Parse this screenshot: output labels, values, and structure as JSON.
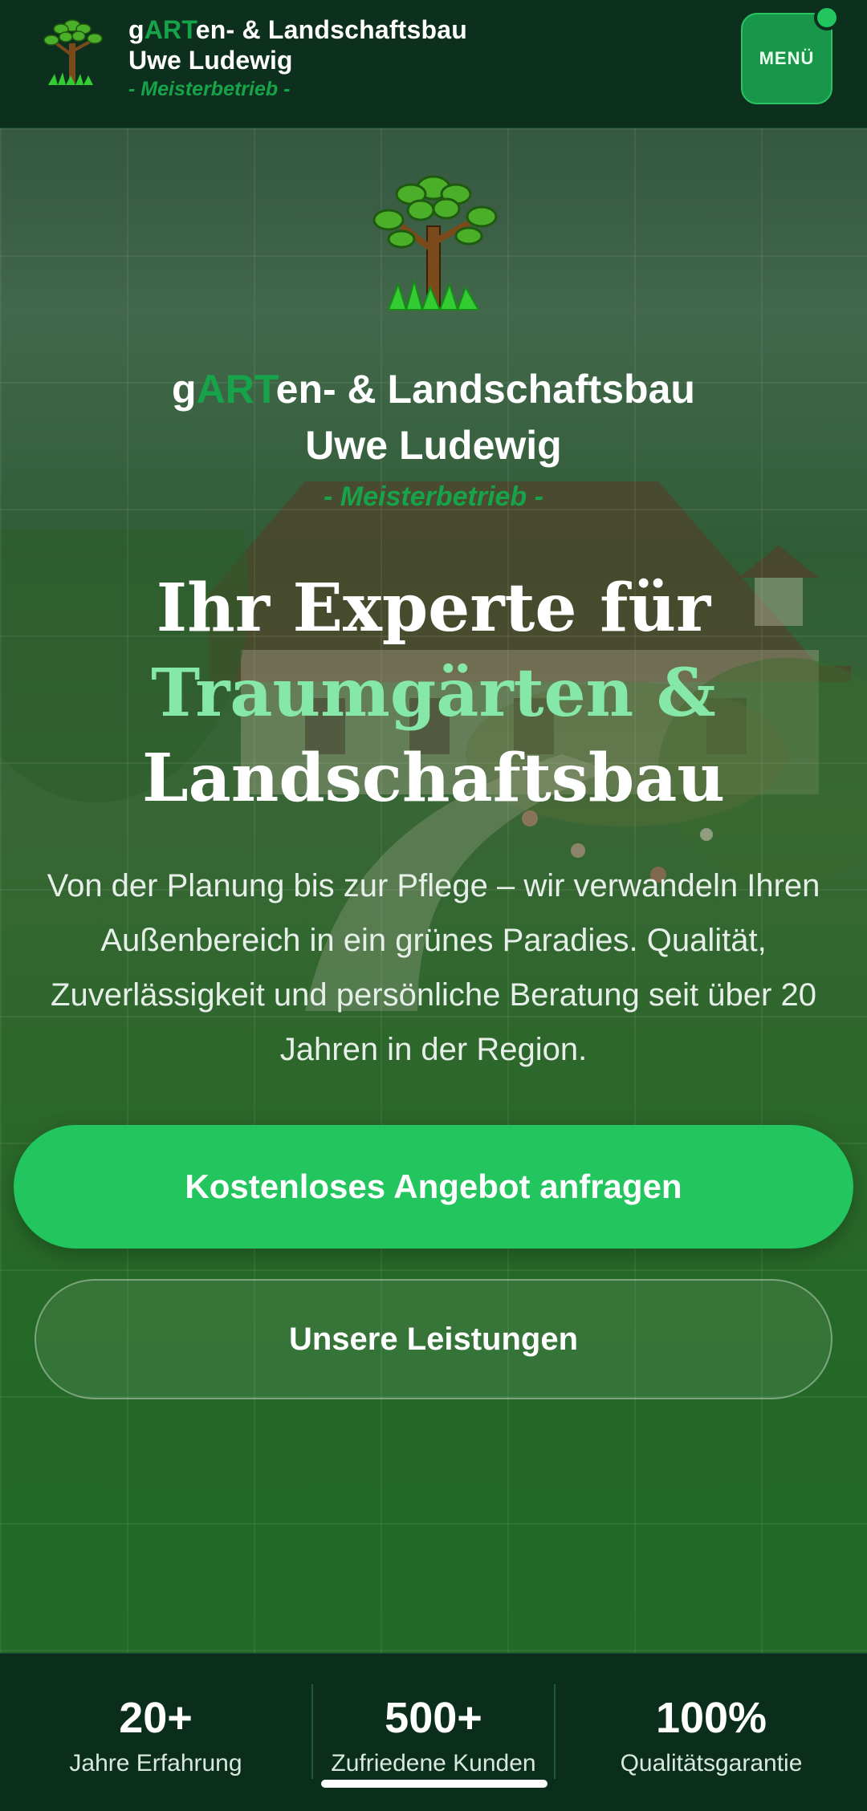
{
  "header": {
    "title_prefix": "g",
    "title_highlight": "ART",
    "title_suffix": "en- & Landschaftsbau",
    "subtitle": "Uwe Ludewig",
    "tagline": "- Meisterbetrieb -",
    "menu_label": "MENÜ",
    "logo_icon": "tree-logo-icon"
  },
  "hero": {
    "name_prefix": "g",
    "name_highlight": "ART",
    "name_suffix": "en- & Landschaftsbau",
    "owner": "Uwe Ludewig",
    "tagline": "- Meisterbetrieb -",
    "headline_1": "Ihr Experte für",
    "headline_accent": "Traumgärten &",
    "headline_2": "Landschaftsbau",
    "lead": "Von der Planung bis zur Pflege – wir verwandeln Ihren Außenbereich in ein grünes Paradies. Qualität, Zuverlässigkeit und persönliche Beratung seit über 20 Jahren in der Region.",
    "cta_primary": "Kostenloses Angebot anfragen",
    "cta_secondary": "Unsere Leistungen"
  },
  "stats": [
    {
      "value": "20+",
      "label": "Jahre Erfahrung"
    },
    {
      "value": "500+",
      "label": "Zufriedene Kunden"
    },
    {
      "value": "100%",
      "label": "Qualitätsgarantie"
    }
  ],
  "colors": {
    "brand_green": "#16a34a",
    "cta_green": "#22c55e",
    "accent_light": "#86e8a8",
    "header_bg": "#0d2f1d"
  }
}
